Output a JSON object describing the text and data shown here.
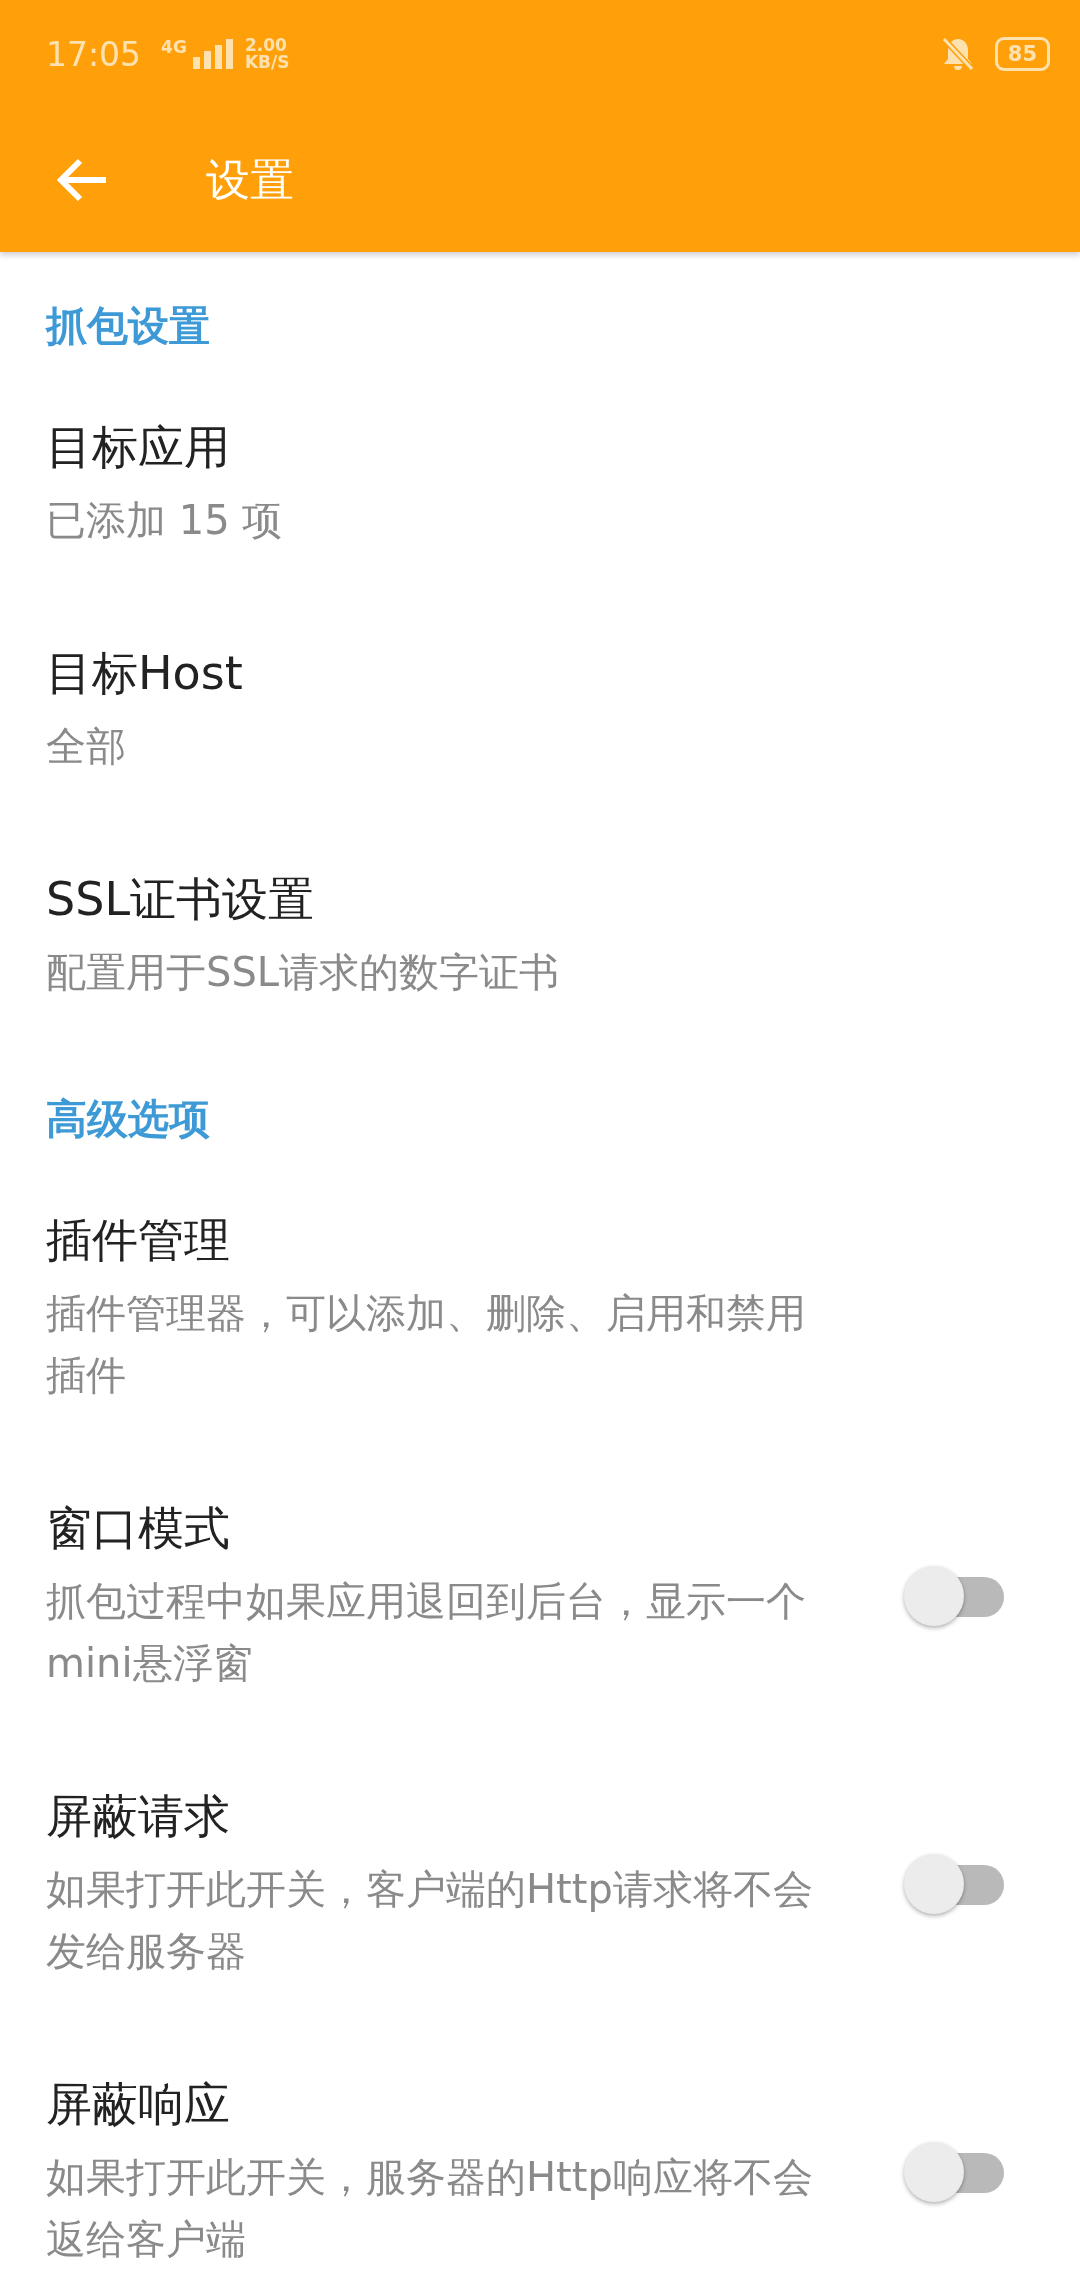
{
  "status_bar": {
    "time": "17:05",
    "network": "4G",
    "speed_value": "2.00",
    "speed_unit": "KB/S",
    "battery": "85"
  },
  "toolbar": {
    "title": "设置"
  },
  "sections": [
    {
      "header": "抓包设置",
      "items": [
        {
          "kind": "plain",
          "title": "目标应用",
          "summary": "已添加 15 项"
        },
        {
          "kind": "plain",
          "title": "目标Host",
          "summary": "全部"
        },
        {
          "kind": "plain",
          "title": "SSL证书设置",
          "summary": "配置用于SSL请求的数字证书"
        }
      ]
    },
    {
      "header": "高级选项",
      "items": [
        {
          "kind": "plain",
          "title": "插件管理",
          "summary": "插件管理器，可以添加、删除、启用和禁用插件"
        },
        {
          "kind": "switch",
          "title": "窗口模式",
          "summary": "抓包过程中如果应用退回到后台，显示一个mini悬浮窗",
          "on": false
        },
        {
          "kind": "switch",
          "title": "屏蔽请求",
          "summary": "如果打开此开关，客户端的Http请求将不会发给服务器",
          "on": false
        },
        {
          "kind": "switch",
          "title": "屏蔽响应",
          "summary": "如果打开此开关，服务器的Http响应将不会返给客户端",
          "on": false
        }
      ]
    }
  ]
}
